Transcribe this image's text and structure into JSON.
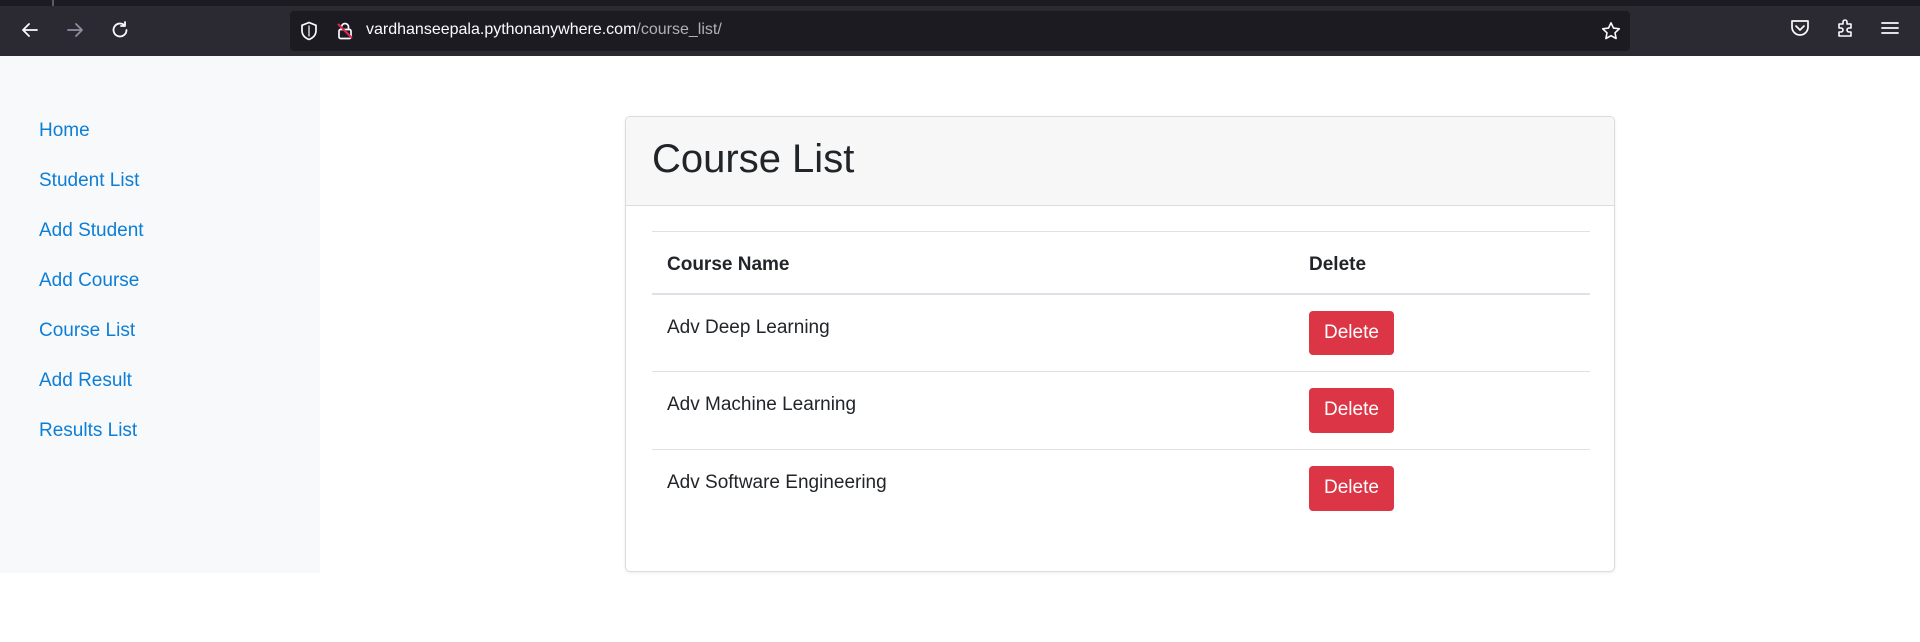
{
  "browser": {
    "url_host": "vardhanseepala.pythonanywhere.com",
    "url_path": "/course_list/",
    "icons": [
      "back-arrow-icon",
      "forward-arrow-icon",
      "reload-icon",
      "shield-icon",
      "lock-icon",
      "star-icon",
      "pocket-icon",
      "extensions-icon",
      "menu-icon"
    ]
  },
  "sidebar": {
    "items": [
      {
        "label": "Home"
      },
      {
        "label": "Student List"
      },
      {
        "label": "Add Student"
      },
      {
        "label": "Add Course"
      },
      {
        "label": "Course List"
      },
      {
        "label": "Add Result"
      },
      {
        "label": "Results List"
      }
    ]
  },
  "main": {
    "title": "Course List",
    "table": {
      "headers": [
        "Course Name",
        "Delete"
      ],
      "rows": [
        {
          "course_name": "Adv Deep Learning",
          "action": "Delete"
        },
        {
          "course_name": "Adv Machine Learning",
          "action": "Delete"
        },
        {
          "course_name": "Adv Software Engineering",
          "action": "Delete"
        }
      ]
    }
  },
  "colors": {
    "link": "#0d7ed6",
    "danger": "#dc3545",
    "chrome": "#2b2a33"
  }
}
